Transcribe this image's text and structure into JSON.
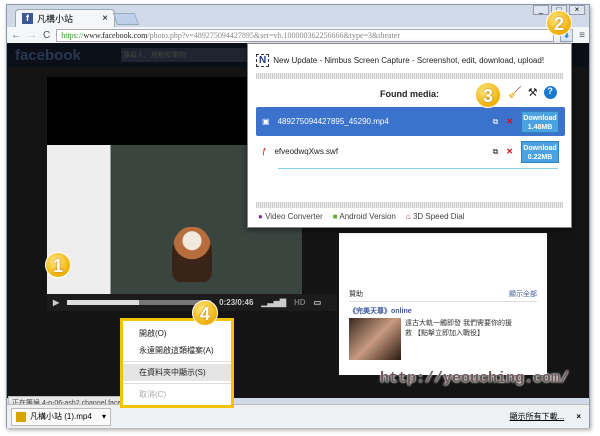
{
  "browser": {
    "tab_title": "凡構小站",
    "url_scheme": "https://",
    "url_host": "www.facebook.com",
    "url_path": "/photo.php?v=489275094427895&set=vb.100000362256666&type=3&theater"
  },
  "facebook": {
    "logo": "facebook",
    "search_placeholder": "搜尋人、地點和事物"
  },
  "video": {
    "time": "0:23/0:46",
    "hd": "HD",
    "progress": 0.5
  },
  "popup": {
    "update": "New Update - Nimbus Screen Capture - Screenshot, edit, download, upload!",
    "found": "Found media:",
    "items": [
      {
        "name": "489275094427895_45290.mp4",
        "dl": "Download",
        "size": "1.48MB"
      },
      {
        "name": "efveodwqXws.swf",
        "dl": "Download",
        "size": "0.22MB"
      }
    ],
    "footer": [
      "Video Converter",
      "Android Version",
      "3D Speed Dial"
    ]
  },
  "sidebar": {
    "sponsored": "贊助",
    "see_all": "顯示全部",
    "ad_title": "《完美天尊》online",
    "ad_text": "遠古大軌一觸即發 我們需要你的援救 【點擊立即加入戰役】"
  },
  "context_menu": {
    "items": [
      "開啟(O)",
      "永遠開啟這類檔案(A)",
      "在資料夾中顯示(S)",
      "取消(C)"
    ]
  },
  "status": "正在等候 4-p-06-ash2.channel.facebook.com...",
  "download": {
    "file": "凡構小站 (1).mp4",
    "show_all": "顯示所有下載..."
  },
  "watermark": "http://yeouching.com/",
  "badges": [
    "1",
    "2",
    "3",
    "4"
  ]
}
